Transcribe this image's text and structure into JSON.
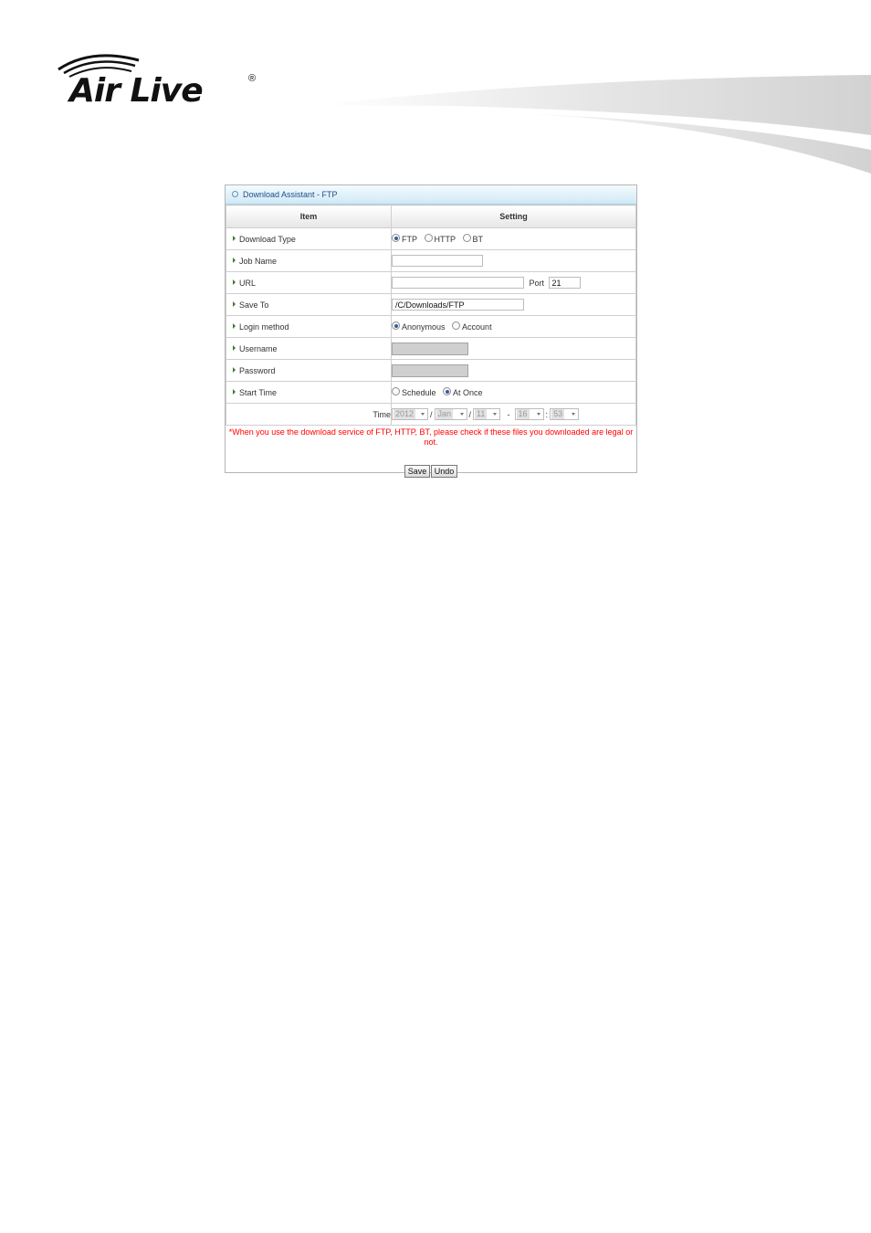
{
  "brand": {
    "logo_text": "Air Live",
    "registered_mark": "®"
  },
  "panel": {
    "title": "Download Assistant - FTP",
    "columns": {
      "item": "Item",
      "setting": "Setting"
    },
    "download_type": {
      "label": "Download Type",
      "options": [
        "FTP",
        "HTTP",
        "BT"
      ],
      "selected": "FTP"
    },
    "job_name": {
      "label": "Job Name",
      "value": ""
    },
    "url": {
      "label": "URL",
      "value": "",
      "port_label": "Port",
      "port_value": "21"
    },
    "save_to": {
      "label": "Save To",
      "value": "/C/Downloads/FTP"
    },
    "login_method": {
      "label": "Login method",
      "options": [
        "Anonymous",
        "Account"
      ],
      "selected": "Anonymous"
    },
    "username": {
      "label": "Username",
      "value": "",
      "disabled": true
    },
    "password": {
      "label": "Password",
      "value": "",
      "disabled": true
    },
    "start_time": {
      "label": "Start Time",
      "options": [
        "Schedule",
        "At Once"
      ],
      "selected": "At Once"
    },
    "time": {
      "label": "Time",
      "year": "2012",
      "month": "Jan",
      "day": "11",
      "hour": "16",
      "minute": "53",
      "sep_date": "/",
      "sep_dash": "-",
      "sep_colon": ":"
    },
    "warning_line1": "*When you use the download service of FTP, HTTP, BT, please check if these files you downloaded are legal or",
    "warning_line2": "not.",
    "buttons": {
      "save": "Save",
      "undo": "Undo"
    }
  }
}
